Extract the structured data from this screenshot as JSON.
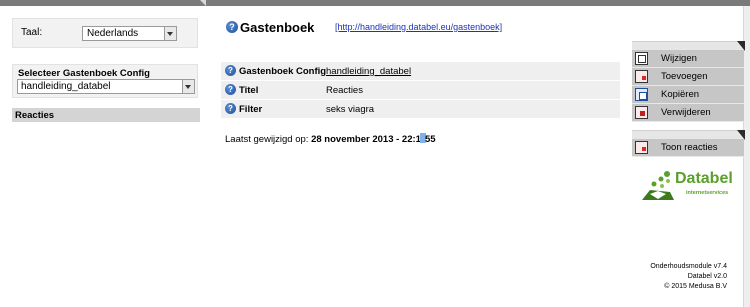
{
  "left": {
    "language_label": "Taal:",
    "language_value": "Nederlands",
    "config_title": "Selecteer Gastenboek Config",
    "config_value": "handleiding_databel",
    "reacties_label": "Reacties"
  },
  "main": {
    "title": "Gastenboek",
    "url": "[http://handleiding.databel.eu/gastenboek]",
    "rows": [
      {
        "key": "Gastenboek Config",
        "value": "handleiding_databel"
      },
      {
        "key": "Titel",
        "value": "Reacties"
      },
      {
        "key": "Filter",
        "value": "seks viagra"
      }
    ],
    "modified_prefix": "Laatst gewijzigd op: ",
    "modified_date_a": "28 november 2013 - 22:1",
    "modified_date_b": "55"
  },
  "menu": {
    "edit": "Wijzigen",
    "add": "Toevoegen",
    "copy": "Kopiëren",
    "delete": "Verwijderen",
    "show_reactions": "Toon reacties"
  },
  "logo": {
    "name": "Databel",
    "tagline": "internetservices"
  },
  "footer": {
    "line1": "Onderhoudsmodule v7.4",
    "line2": "Databel v2.0",
    "line3": "© 2015 Medusa B.V"
  },
  "colors": {
    "accent_green": "#5aa02c",
    "menu_gray": "#c6c6c6",
    "link_blue": "#1a35b5"
  }
}
